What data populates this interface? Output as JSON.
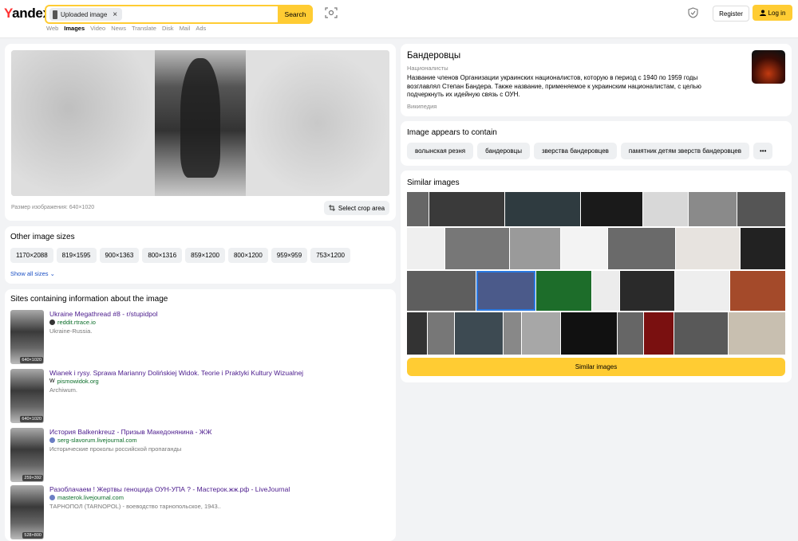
{
  "header": {
    "logo_y": "Y",
    "logo_rest": "andex",
    "search_chip": "Uploaded image",
    "search_button": "Search",
    "nav": [
      "Web",
      "Images",
      "Video",
      "News",
      "Translate",
      "Disk",
      "Mail",
      "Ads"
    ],
    "nav_active": "Images",
    "register": "Register",
    "login": "Log in"
  },
  "preview": {
    "size_text": "Размер изображения: 640×1020",
    "crop_button": "Select crop area"
  },
  "other_sizes": {
    "title": "Other image sizes",
    "sizes": [
      "1170×2088",
      "819×1595",
      "900×1363",
      "800×1316",
      "859×1200",
      "800×1200",
      "959×959",
      "753×1200"
    ],
    "show_all": "Show all sizes"
  },
  "sites": {
    "title": "Sites containing information about the image",
    "items": [
      {
        "title": "Ukraine Megathread #8 - r/stupidpol",
        "host": "reddit.rtrace.io",
        "desc": "Ukraine-Russia.",
        "size": "640×1020"
      },
      {
        "title": "Wianek i rysy. Sprawa Marianny Dolińskiej Widok. Teorie i Praktyki Kultury Wizualnej",
        "host": "pismowidok.org",
        "desc": "Archiwum.",
        "size": "640×1020"
      },
      {
        "title": "История Balkenkreuz - Призыв Македонянина - ЖЖ",
        "host": "serg-slavorum.livejournal.com",
        "desc": "Исторические проколы российской пропаганды",
        "size": "259×392"
      },
      {
        "title": "Разоблачаем ! Жертвы геноцида ОУН-УПА ? - Мастерок.жж.рф - LiveJournal",
        "host": "masterok.livejournal.com",
        "desc": "ТАРНОПОЛ (TARNOPOL) - воеводство тарнопольское, 1943..",
        "size": "528×800"
      }
    ]
  },
  "entity": {
    "title": "Бандеровцы",
    "subtitle": "Националисты",
    "desc_line1": "Название членов Организации украинских националистов, которую в период с 1940 по 1959 годы",
    "desc_line2": "возглавлял Степан Бандера. Также название, применяемое к украинским националистам, с целью",
    "desc_line3": "подчеркнуть их идейную связь с ОУН.",
    "source": "Википедия"
  },
  "contains": {
    "title": "Image appears to contain",
    "tags": [
      "волынская резня",
      "бандеровцы",
      "зверства бандеровцев",
      "памятник детям зверств бандеровцев"
    ],
    "more": "•••"
  },
  "similar": {
    "title": "Similar images",
    "button": "Similar images"
  }
}
